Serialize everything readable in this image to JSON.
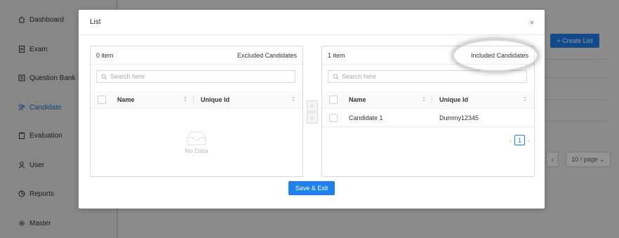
{
  "sidebar": {
    "items": [
      {
        "label": "Dashboard",
        "icon": "home-icon"
      },
      {
        "label": "Exam",
        "icon": "document-icon"
      },
      {
        "label": "Question Bank",
        "icon": "book-icon"
      },
      {
        "label": "Candidate",
        "icon": "users-icon",
        "active": true
      },
      {
        "label": "Evaluation",
        "icon": "clipboard-icon"
      },
      {
        "label": "User",
        "icon": "user-icon"
      },
      {
        "label": "Reports",
        "icon": "chart-pie-icon"
      },
      {
        "label": "Master",
        "icon": "gear-icon"
      }
    ]
  },
  "background": {
    "create_list_label": "+ Create List",
    "page_size_label": "10 / page"
  },
  "modal": {
    "title": "List",
    "close_glyph": "×",
    "save_label": "Save & Exit",
    "left_panel": {
      "count": "0 item",
      "title": "Excluded Candidates",
      "search_placeholder": "Search here",
      "columns": [
        "Name",
        "Unique Id"
      ],
      "empty_text": "No Data",
      "rows": []
    },
    "right_panel": {
      "count": "1 item",
      "title": "Included Candidates",
      "search_placeholder": "Search here",
      "columns": [
        "Name",
        "Unique Id"
      ],
      "rows": [
        {
          "name": "Candidate 1",
          "unique_id": "Dummy12345"
        }
      ],
      "page": "1"
    }
  },
  "colors": {
    "accent": "#1f80f0",
    "active_nav": "#1f6fd6"
  }
}
